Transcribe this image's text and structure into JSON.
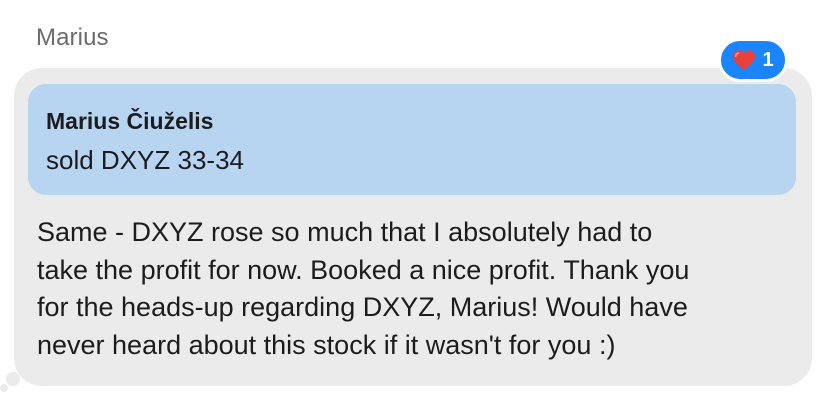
{
  "message": {
    "sender_name": "Marius",
    "reply_quote": {
      "author": "Marius Čiuželis",
      "text": "sold DXYZ 33-34"
    },
    "lines": [
      "Same - DXYZ rose so much that I absolutely had to",
      "take the profit for now. Booked a nice profit. Thank you",
      "for the heads-up regarding DXYZ, Marius! Would have",
      "never heard about this stock if it wasn't for you :)"
    ],
    "reaction": {
      "icon": "heart-icon",
      "count": "1"
    }
  },
  "colors": {
    "bubble": "#ebebeb",
    "quote": "#b7d5f1",
    "reaction_badge": "#1a85ff",
    "heart": "#e8413c"
  }
}
